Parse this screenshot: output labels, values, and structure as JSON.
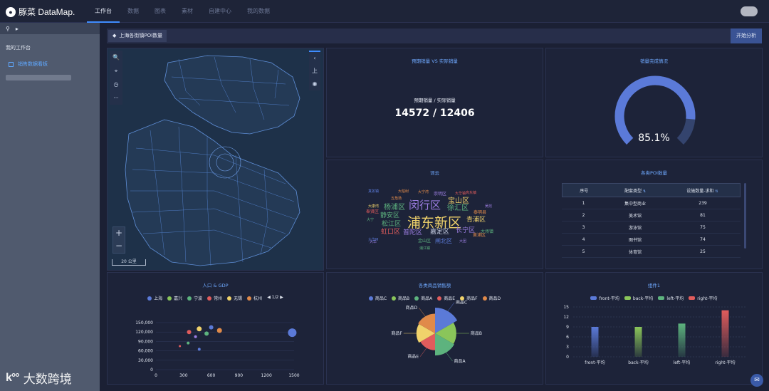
{
  "app": {
    "logo_text": "豚菜 DataMap."
  },
  "nav": [
    "工作台",
    "数据",
    "图表",
    "素材",
    "自建中心",
    "我的数据"
  ],
  "sidebar": {
    "search_icon": "search-icon",
    "play_icon": "play-icon",
    "title": "我的工作台",
    "item": "销售数据看板"
  },
  "watermark": "大数跨境",
  "titlebar": {
    "label": "上海各街镇POI数量",
    "button": "开始分析"
  },
  "map": {
    "tools": [
      "🔍",
      "⌖",
      "◷",
      "···"
    ],
    "right": [
      "‹",
      "上",
      "◉"
    ],
    "zoom_in": "+",
    "zoom_out": "−",
    "scale": "20 公里"
  },
  "sales": {
    "title": "预期销量 VS 实际销量",
    "label": "预期销量 / 实际销量",
    "value": "14572 / 12406"
  },
  "gauge": {
    "title": "销量完成情况",
    "value_text": "85.1%",
    "value": 0.851
  },
  "wordcloud": {
    "title": "词云",
    "words": [
      {
        "t": "浦东新区",
        "c": "#f0d26b",
        "s": 19
      },
      {
        "t": "闵行区",
        "c": "#9b7de0",
        "s": 15
      },
      {
        "t": "徐汇区",
        "c": "#5db37e",
        "s": 10
      },
      {
        "t": "宝山区",
        "c": "#f0d26b",
        "s": 10
      },
      {
        "t": "杨浦区",
        "c": "#5db37e",
        "s": 10
      },
      {
        "t": "静安区",
        "c": "#5db37e",
        "s": 9
      },
      {
        "t": "松江区",
        "c": "#5db37e",
        "s": 9
      },
      {
        "t": "虹口区",
        "c": "#e05c5c",
        "s": 9
      },
      {
        "t": "普陀区",
        "c": "#9b7de0",
        "s": 9
      },
      {
        "t": "嘉定区",
        "c": "#c9d1e6",
        "s": 9
      },
      {
        "t": "长宁区",
        "c": "#9b7de0",
        "s": 9
      },
      {
        "t": "青浦区",
        "c": "#f0d26b",
        "s": 9
      },
      {
        "t": "闸北区",
        "c": "#5b7ad8",
        "s": 8
      },
      {
        "t": "金山区",
        "c": "#5db37e",
        "s": 6
      },
      {
        "t": "黄浦区",
        "c": "#e08a4a",
        "s": 6
      },
      {
        "t": "奉贤区",
        "c": "#e05c5c",
        "s": 6
      },
      {
        "t": "崇明区",
        "c": "#9b7de0",
        "s": 6
      },
      {
        "t": "泰明县",
        "c": "#e08a4a",
        "s": 6
      },
      {
        "t": "大场镇",
        "c": "#5db37e",
        "s": 6
      },
      {
        "t": "五角场",
        "c": "#e08a4a",
        "s": 5
      },
      {
        "t": "大宁",
        "c": "#5db37e",
        "s": 5
      },
      {
        "t": "大华",
        "c": "#9b7de0",
        "s": 5
      },
      {
        "t": "大华镇",
        "c": "#e05c5c",
        "s": 5
      },
      {
        "t": "真如镇",
        "c": "#5b7ad8",
        "s": 5
      },
      {
        "t": "大柏树",
        "c": "#e08a4a",
        "s": 5
      },
      {
        "t": "大康湾",
        "c": "#f0d26b",
        "s": 5
      },
      {
        "t": "大团",
        "c": "#9b7de0",
        "s": 5
      },
      {
        "t": "高东镇",
        "c": "#e05c5c",
        "s": 5
      },
      {
        "t": "吴淞",
        "c": "#9b7de0",
        "s": 5
      },
      {
        "t": "大宁湾",
        "c": "#e08a4a",
        "s": 5
      },
      {
        "t": "浦江镇",
        "c": "#5db37e",
        "s": 5
      },
      {
        "t": "大华M",
        "c": "#5b7ad8",
        "s": 5
      }
    ]
  },
  "table": {
    "title": "各类POI数量",
    "headers": [
      "序号",
      "配套类型",
      "设施数量-求和"
    ],
    "rows": [
      [
        "1",
        "集中型商业",
        "239"
      ],
      [
        "2",
        "美术馆",
        "81"
      ],
      [
        "3",
        "游泳馆",
        "75"
      ],
      [
        "4",
        "图书馆",
        "74"
      ],
      [
        "5",
        "体育馆",
        "25"
      ]
    ]
  },
  "chart_data": [
    {
      "type": "scatter",
      "title": "人口 & GDP",
      "legend": [
        "上海",
        "嘉兴",
        "宁波",
        "常州",
        "无锡",
        "杭州"
      ],
      "legend_colors": [
        "#5b7ad8",
        "#8ac55a",
        "#5db37e",
        "#e05c5c",
        "#f0d26b",
        "#e08a4a"
      ],
      "legend_page": "1/2",
      "xticks": [
        "0",
        "300",
        "600",
        "900",
        "1200",
        "1500"
      ],
      "yticks": [
        "0",
        "30,000",
        "60,000",
        "90,000",
        "120,000",
        "150,000"
      ],
      "xlim": [
        0,
        1500
      ],
      "ylim": [
        0,
        150000
      ],
      "points": [
        {
          "x": 1480,
          "y": 118000,
          "r": 6,
          "c": "#5b7ad8"
        },
        {
          "x": 690,
          "y": 125000,
          "r": 3.5,
          "c": "#e08a4a"
        },
        {
          "x": 600,
          "y": 135000,
          "r": 3,
          "c": "#5b7ad8"
        },
        {
          "x": 470,
          "y": 130000,
          "r": 3.5,
          "c": "#f0d26b"
        },
        {
          "x": 550,
          "y": 115000,
          "r": 3,
          "c": "#5db37e"
        },
        {
          "x": 360,
          "y": 120000,
          "r": 3,
          "c": "#e05c5c"
        },
        {
          "x": 430,
          "y": 105000,
          "r": 2,
          "c": "#9b7de0"
        },
        {
          "x": 470,
          "y": 65000,
          "r": 2,
          "c": "#5b7ad8"
        },
        {
          "x": 350,
          "y": 85000,
          "r": 2,
          "c": "#5db37e"
        },
        {
          "x": 260,
          "y": 75000,
          "r": 1.5,
          "c": "#e05c5c"
        }
      ]
    },
    {
      "type": "pie",
      "title": "各类商品销售额",
      "categories": [
        "商品C",
        "商品B",
        "商品A",
        "商品E",
        "商品F",
        "商品D"
      ],
      "colors": [
        "#5b7ad8",
        "#8ac55a",
        "#5db37e",
        "#e05c5c",
        "#f0d26b",
        "#e08a4a"
      ],
      "values": [
        36,
        26,
        28,
        16,
        20,
        22
      ]
    },
    {
      "type": "bar",
      "title": "组件1",
      "categories": [
        "front-平均",
        "back-平均",
        "left-平均",
        "right-平均"
      ],
      "series": [
        {
          "name": "front-平均",
          "color": "#5b7ad8",
          "value": 9
        },
        {
          "name": "back-平均",
          "color": "#8ac55a",
          "value": 9
        },
        {
          "name": "left-平均",
          "color": "#5db37e",
          "value": 10
        },
        {
          "name": "right-平均",
          "color": "#e05c5c",
          "value": 14
        }
      ],
      "ylim": [
        0,
        15
      ],
      "yticks": [
        "0",
        "3",
        "6",
        "9",
        "12",
        "15"
      ]
    }
  ],
  "chat_icon": "chat-icon"
}
